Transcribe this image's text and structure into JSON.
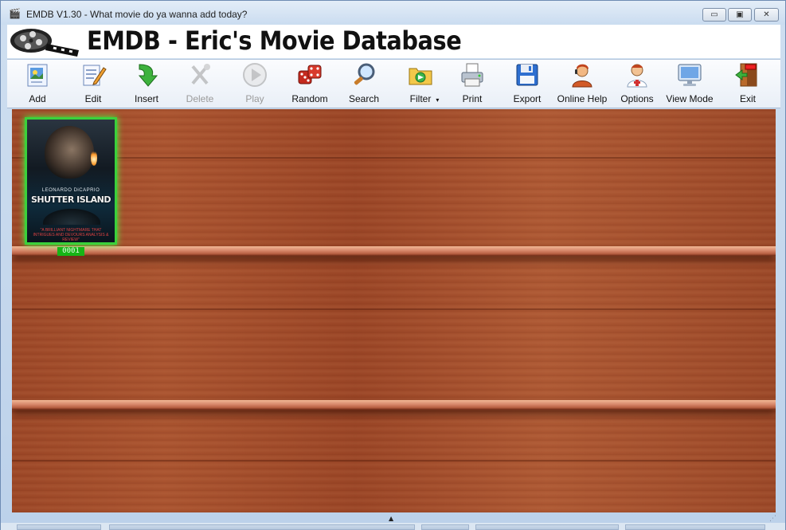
{
  "window": {
    "title": "EMDB V1.30 - What movie do ya wanna add today?",
    "minimize_symbol": "▭",
    "maximize_symbol": "▣",
    "close_symbol": "✕"
  },
  "banner": {
    "title": "EMDB - Eric's Movie Database"
  },
  "toolbar": {
    "items": [
      {
        "label": "Add",
        "icon": "add-movie-icon",
        "enabled": true
      },
      {
        "label": "Edit",
        "icon": "edit-icon",
        "enabled": true
      },
      {
        "label": "Insert",
        "icon": "insert-arrow-icon",
        "enabled": true
      },
      {
        "label": "Delete",
        "icon": "delete-tools-icon",
        "enabled": false
      },
      {
        "label": "Play",
        "icon": "play-icon",
        "enabled": false
      },
      {
        "label": "Random",
        "icon": "dice-icon",
        "enabled": true
      },
      {
        "label": "Search",
        "icon": "magnifier-icon",
        "enabled": true
      },
      {
        "label": "Filter",
        "icon": "filter-folder-icon",
        "enabled": true,
        "dropdown": "▾"
      },
      {
        "label": "Print",
        "icon": "printer-icon",
        "enabled": true
      },
      {
        "label": "Export",
        "icon": "floppy-disk-icon",
        "enabled": true
      },
      {
        "label": "Online Help",
        "icon": "help-person-icon",
        "enabled": true
      },
      {
        "label": "Options",
        "icon": "options-doctor-icon",
        "enabled": true
      },
      {
        "label": "View Mode",
        "icon": "monitor-icon",
        "enabled": true
      },
      {
        "label": "Exit",
        "icon": "exit-door-icon",
        "enabled": true
      }
    ]
  },
  "shelf": {
    "movies": [
      {
        "number": "0001",
        "cover_actor": "LEONARDO DiCAPRIO",
        "cover_title": "SHUTTER ISLAND",
        "cover_tagline": "\"A BRILLIANT NIGHTMARE THAT INTRIGUES AND DEVOURS ANALYSIS & REVIEW\""
      }
    ]
  },
  "status": {
    "scroll_symbol": "▲"
  },
  "colors": {
    "selection_border": "#3bd13b",
    "number_badge": "#16b516",
    "wood": "#a04b2a"
  }
}
